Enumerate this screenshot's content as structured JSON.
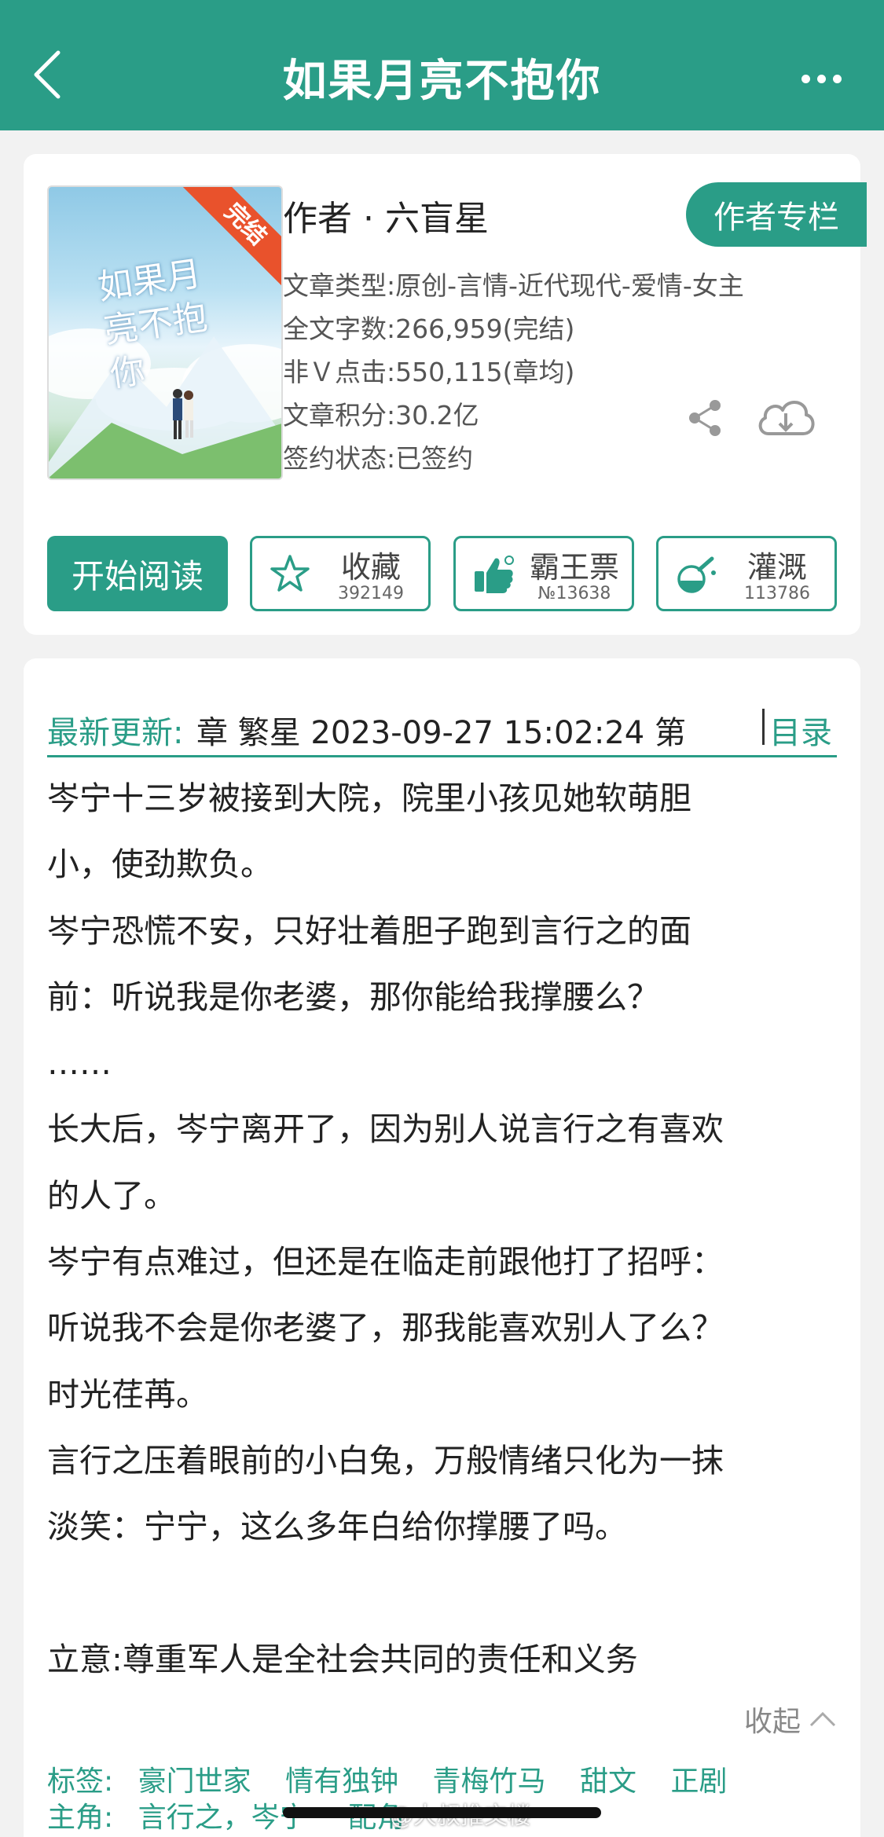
{
  "header": {
    "title": "如果月亮不抱你",
    "back_icon": "chevron-left-icon",
    "more_icon": "more-horizontal-icon"
  },
  "book": {
    "cover_title": "如果月亮不抱你",
    "cover_badge": "完结",
    "author_line": "作者 · 六盲星",
    "author_column_label": "作者专栏",
    "meta": [
      "文章类型:原创-言情-近代现代-爱情-女主",
      "全文字数:266,959(完结)",
      "非Ｖ点击:550,115(章均)",
      "文章积分:30.2亿",
      "签约状态:已签约"
    ]
  },
  "actions": {
    "read_label": "开始阅读",
    "favorite": {
      "label": "收藏",
      "count": "392149"
    },
    "tickets": {
      "label": "霸王票",
      "count": "№13638"
    },
    "nutrient": {
      "label": "灌溉",
      "count": "113786"
    }
  },
  "update": {
    "label": "最新更新:",
    "text": "章 繁星 2023-09-27 15:02:24   第",
    "toc_label": "目录"
  },
  "summary": [
    "岑宁十三岁被接到大院，院里小孩见她软萌胆",
    "小，使劲欺负。",
    "岑宁恐慌不安，只好壮着胆子跑到言行之的面",
    "前：听说我是你老婆，那你能给我撑腰么？",
    "……",
    "长大后，岑宁离开了，因为别人说言行之有喜欢",
    "的人了。",
    "岑宁有点难过，但还是在临走前跟他打了招呼：",
    "听说我不会是你老婆了，那我能喜欢别人了么？",
    "时光荏苒。",
    "言行之压着眼前的小白兔，万般情绪只化为一抹",
    "淡笑：宁宁，这么多年白给你撑腰了吗。",
    "",
    "立意:尊重军人是全社会共同的责任和义务"
  ],
  "collapse_label": "收起",
  "tags": {
    "label": "标签:",
    "items": [
      "豪门世家",
      "情有独钟",
      "青梅竹马",
      "甜文",
      "正剧"
    ]
  },
  "roles": {
    "label": "主角:",
    "main": "言行之，岑宁",
    "support": "配角"
  },
  "watermark": "@大叔推文楼",
  "colors": {
    "accent": "#2a9d87",
    "background": "#f2f2f2"
  }
}
